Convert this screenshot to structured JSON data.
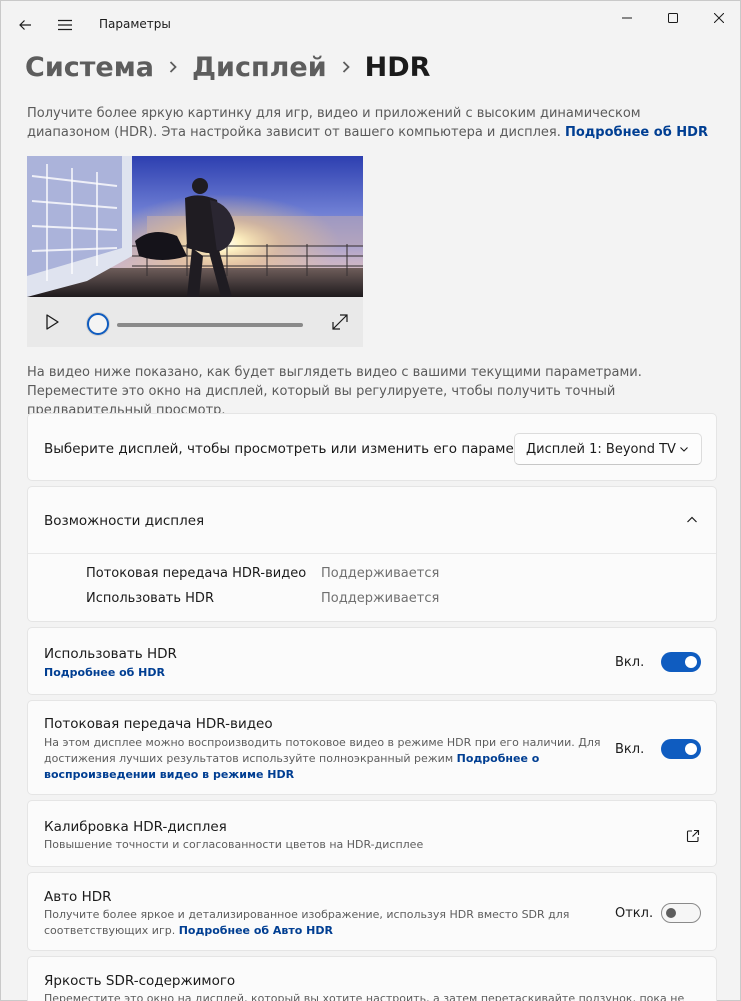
{
  "window": {
    "app_title": "Параметры"
  },
  "breadcrumb": {
    "items": [
      "Система",
      "Дисплей"
    ],
    "current": "HDR"
  },
  "intro": {
    "text": "Получите более яркую картинку для игр, видео и приложений с высоким динамическом диапазоном (HDR). Эта настройка зависит от вашего компьютера и дисплея.",
    "link": "Подробнее об HDR"
  },
  "player": {
    "progress": 0
  },
  "preview_note": "На видео ниже показано, как будет выглядеть видео с вашими текущими параметрами. Переместите это окно на дисплей, который вы регулируете, чтобы получить точный предварительный просмотр.",
  "display_select": {
    "label": "Выберите дисплей, чтобы просмотреть или изменить его параметры",
    "value": "Дисплей 1: Beyond TV"
  },
  "capabilities": {
    "title": "Возможности дисплея",
    "expanded": true,
    "rows": [
      {
        "label": "Потоковая передача HDR-видео",
        "value": "Поддерживается"
      },
      {
        "label": "Использовать HDR",
        "value": "Поддерживается"
      }
    ]
  },
  "use_hdr": {
    "title": "Использовать HDR",
    "link": "Подробнее об HDR",
    "state": "Вкл.",
    "on": true
  },
  "hdr_streaming": {
    "title": "Потоковая передача HDR-видео",
    "description": "На этом дисплее можно воспроизводить потоковое видео в режиме HDR при его наличии. Для достижения лучших результатов используйте полноэкранный режим",
    "link": "Подробнее о воспроизведении видео в режиме HDR",
    "state": "Вкл.",
    "on": true
  },
  "calibration": {
    "title": "Калибровка HDR-дисплея",
    "description": "Повышение точности и согласованности цветов на HDR-дисплее"
  },
  "auto_hdr": {
    "title": "Авто HDR",
    "description": "Получите более яркое и детализированное изображение, используя HDR вместо SDR для соответствующих игр.",
    "link": "Подробнее об Авто HDR",
    "state": "Откл.",
    "on": false
  },
  "sdr_brightness": {
    "title": "Яркость SDR-содержимого",
    "description": "Переместите это окно на дисплей, который вы хотите настроить, а затем перетаскивайте ползунок, пока не"
  },
  "colors": {
    "accent": "#0f5cc0",
    "link": "#003e92",
    "background": "#f3f3f3",
    "card": "#fbfbfb"
  }
}
